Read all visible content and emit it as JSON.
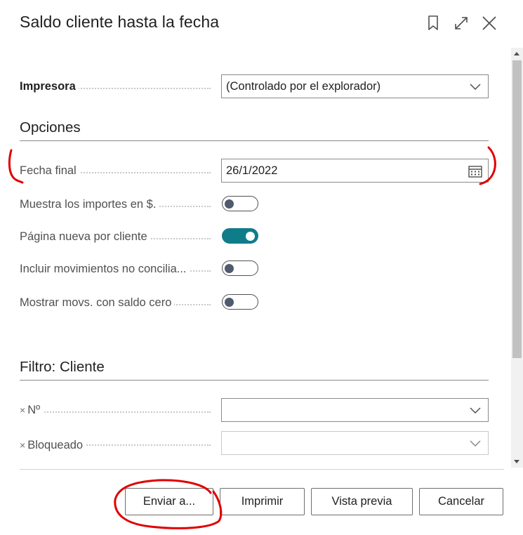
{
  "dialog": {
    "title": "Saldo cliente hasta la fecha",
    "icons": [
      "bookmark-icon",
      "expand-icon",
      "close-icon"
    ]
  },
  "printer": {
    "label": "Impresora",
    "value": "(Controlado por el explorador)"
  },
  "options": {
    "heading": "Opciones",
    "end_date": {
      "label": "Fecha final",
      "value": "26/1/2022"
    },
    "toggles": [
      {
        "label": "Muestra los importes en $.",
        "on": false
      },
      {
        "label": "Página nueva por cliente",
        "on": true
      },
      {
        "label": "Incluir movimientos no concilia...",
        "on": false
      },
      {
        "label": "Mostrar movs. con saldo cero",
        "on": false
      }
    ]
  },
  "filter": {
    "heading": "Filtro: Cliente",
    "fields": [
      {
        "remove": "×",
        "label": "Nº",
        "value": ""
      },
      {
        "remove": "×",
        "label": "Bloqueado",
        "value": ""
      }
    ]
  },
  "buttons": {
    "send": "Enviar a...",
    "print": "Imprimir",
    "preview": "Vista previa",
    "cancel": "Cancelar"
  },
  "colors": {
    "accent": "#0f7c8a",
    "annotation": "#e00000"
  }
}
